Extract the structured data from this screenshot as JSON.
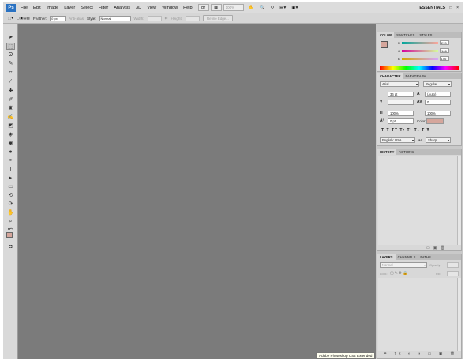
{
  "app": {
    "logo": "Ps",
    "workspace": "ESSENTIALS",
    "tooltip": "Adobe Photoshop CS4 Extended"
  },
  "menu": [
    "File",
    "Edit",
    "Image",
    "Layer",
    "Select",
    "Filter",
    "Analysis",
    "3D",
    "View",
    "Window",
    "Help"
  ],
  "appbar": {
    "zoom": "100%",
    "window_controls": "- □ ×"
  },
  "options": {
    "feather_label": "Feather:",
    "feather_value": "0 px",
    "antialias_label": "Anti-alias",
    "style_label": "Style:",
    "style_value": "Normal",
    "width_label": "Width:",
    "height_label": "Height:",
    "refine_label": "Refine Edge..."
  },
  "color_panel": {
    "tabs": [
      "COLOR",
      "SWATCHES",
      "STYLES"
    ],
    "channels": [
      {
        "name": "R",
        "value": "213"
      },
      {
        "name": "G",
        "value": "166"
      },
      {
        "name": "B",
        "value": "156"
      }
    ],
    "foreground": "#d5a69c"
  },
  "character_panel": {
    "tabs": [
      "CHARACTER",
      "PARAGRAPH"
    ],
    "font": "Arial",
    "font_style": "Regular",
    "size": "36 pt",
    "leading": "(Auto)",
    "kerning": "",
    "tracking": "0",
    "vscale": "100%",
    "hscale": "100%",
    "baseline": "0 pt",
    "color_label": "Color:",
    "type_buttons": "T  T  TT Tr T¹ T₁  T  Ŧ",
    "language": "English: USA",
    "aa_prefix": "aa",
    "antialias": "Sharp"
  },
  "history_panel": {
    "tabs": [
      "HISTORY",
      "ACTIONS"
    ]
  },
  "layers_panel": {
    "tabs": [
      "LAYERS",
      "CHANNELS",
      "PATHS"
    ],
    "blend": "Normal",
    "opacity_label": "Opacity:",
    "lock_label": "Lock:",
    "fill_label": "Fill:"
  }
}
